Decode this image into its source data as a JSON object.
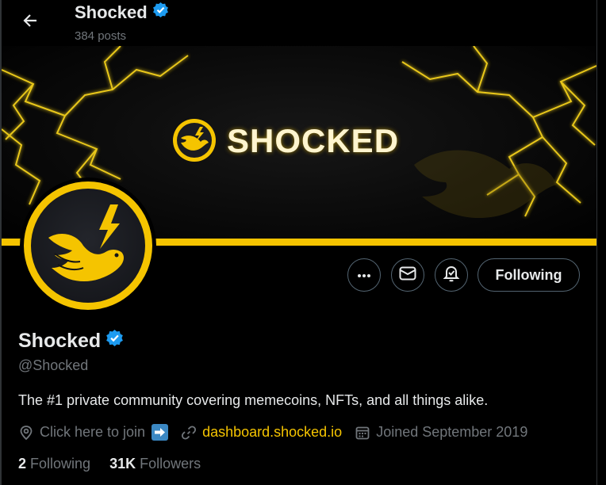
{
  "topbar": {
    "back_icon": "arrow-left-icon",
    "name": "Shocked",
    "posts": "384 posts"
  },
  "banner": {
    "brand_text": "SHOCKED",
    "accent_color": "#f5c400"
  },
  "profile": {
    "name": "Shocked",
    "verified_icon": "verified-badge-icon",
    "handle": "@Shocked",
    "bio": "The #1 private community covering memecoins, NFTs, and all things alike."
  },
  "actions": {
    "more_icon": "more-dots-icon",
    "message_icon": "mail-icon",
    "notify_icon": "bell-plus-icon",
    "follow_label": "Following"
  },
  "meta": {
    "location": "Click here to join",
    "link": "dashboard.shocked.io",
    "joined": "Joined September 2019"
  },
  "stats": {
    "following_count": "2",
    "following_label": "Following",
    "followers_count": "31K",
    "followers_label": "Followers"
  }
}
